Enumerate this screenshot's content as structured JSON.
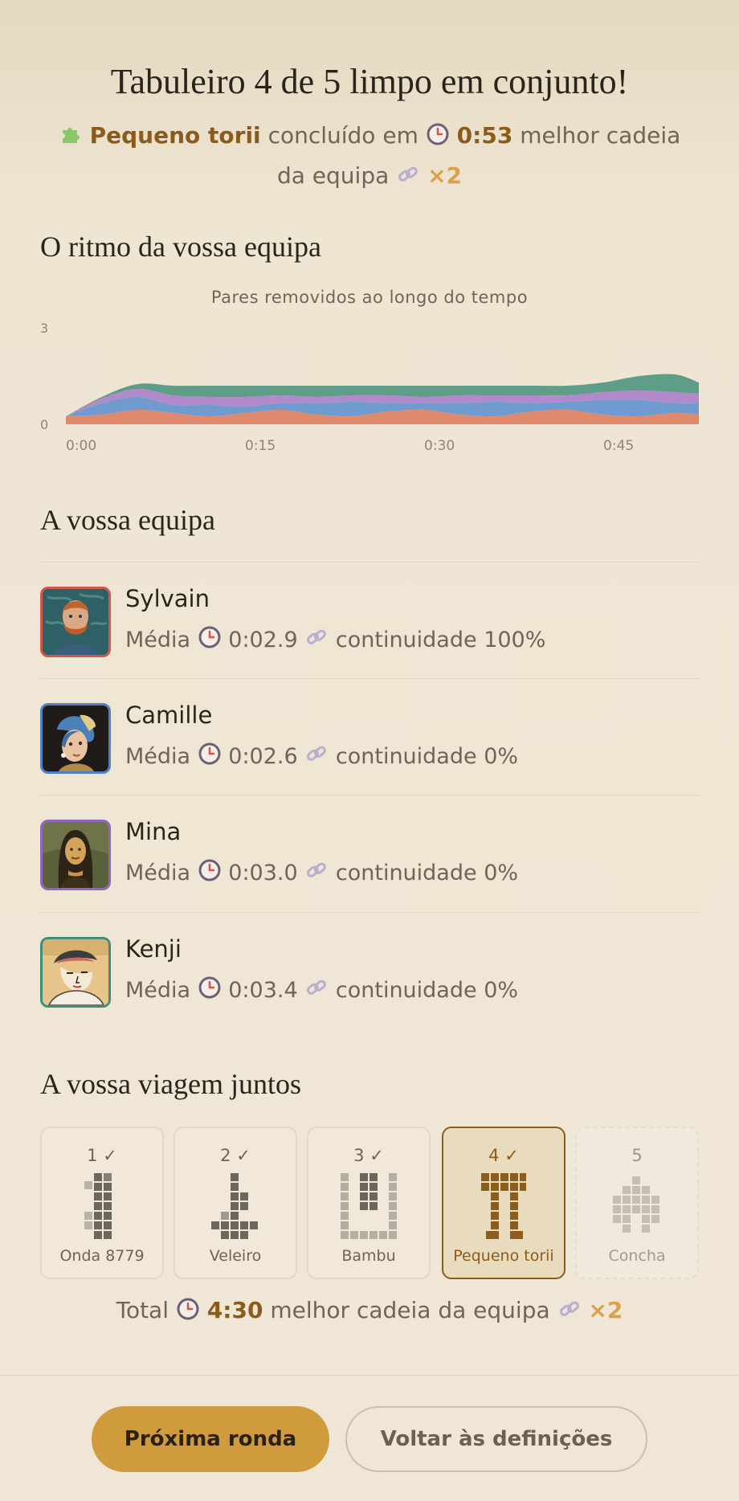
{
  "header": {
    "title": "Tabuleiro 4 de 5 limpo em conjunto!",
    "puzzle_name": "Pequeno torii",
    "completed_in": "concluído em",
    "time": "0:53",
    "best_chain_label": "melhor cadeia da equipa",
    "best_chain": "×2"
  },
  "rhythm": {
    "heading": "O ritmo da vossa equipa",
    "chart_title": "Pares removidos ao longo do tempo"
  },
  "chart_data": {
    "type": "area",
    "stacked": true,
    "title": "Pares removidos ao longo do tempo",
    "x_ticks": [
      "0:00",
      "0:15",
      "0:30",
      "0:45"
    ],
    "y_ticks": [
      "0",
      "3"
    ],
    "ylim": [
      0,
      3
    ],
    "x": [
      0,
      3,
      6,
      9,
      12,
      15,
      18,
      21,
      24,
      27,
      30,
      33,
      36,
      39,
      42,
      45,
      48,
      51,
      53
    ],
    "series": [
      {
        "color": "#e08a6d",
        "values": [
          0.25,
          0.3,
          0.45,
          0.35,
          0.25,
          0.35,
          0.45,
          0.3,
          0.25,
          0.4,
          0.45,
          0.3,
          0.25,
          0.4,
          0.45,
          0.3,
          0.25,
          0.35,
          0.3
        ]
      },
      {
        "color": "#6f9bd0",
        "values": [
          0,
          0.35,
          0.4,
          0.25,
          0.35,
          0.2,
          0.2,
          0.35,
          0.45,
          0.25,
          0.2,
          0.35,
          0.45,
          0.25,
          0.25,
          0.45,
          0.5,
          0.3,
          0.35
        ]
      },
      {
        "color": "#b08acb",
        "values": [
          0,
          0.15,
          0.25,
          0.3,
          0.25,
          0.3,
          0.25,
          0.2,
          0.2,
          0.25,
          0.2,
          0.25,
          0.2,
          0.25,
          0.2,
          0.25,
          0.3,
          0.35,
          0.3
        ]
      },
      {
        "color": "#5e9e88",
        "values": [
          0,
          0.05,
          0.15,
          0.3,
          0.35,
          0.35,
          0.3,
          0.35,
          0.3,
          0.3,
          0.35,
          0.3,
          0.3,
          0.3,
          0.3,
          0.3,
          0.45,
          0.55,
          0.35
        ]
      }
    ]
  },
  "team": {
    "heading": "A vossa equipa",
    "avg_label": "Média",
    "continuity_label": "continuidade",
    "players": [
      {
        "name": "Sylvain",
        "avg": "0:02.9",
        "continuity": "100%",
        "color": "#d0584a"
      },
      {
        "name": "Camille",
        "avg": "0:02.6",
        "continuity": "0%",
        "color": "#4f7fc4"
      },
      {
        "name": "Mina",
        "avg": "0:03.0",
        "continuity": "0%",
        "color": "#9166c0"
      },
      {
        "name": "Kenji",
        "avg": "0:03.4",
        "continuity": "0%",
        "color": "#3d8f78"
      }
    ]
  },
  "journey": {
    "heading": "A vossa viagem juntos",
    "boards": [
      {
        "num": "1 ✓",
        "name": "Onda 8779",
        "state": "done"
      },
      {
        "num": "2 ✓",
        "name": "Veleiro",
        "state": "done"
      },
      {
        "num": "3 ✓",
        "name": "Bambu",
        "state": "done"
      },
      {
        "num": "4 ✓",
        "name": "Pequeno torii",
        "state": "current"
      },
      {
        "num": "5",
        "name": "Concha",
        "state": "locked"
      }
    ],
    "total_label": "Total",
    "total_time": "4:30",
    "best_chain_label": "melhor cadeia da equipa",
    "best_chain": "×2"
  },
  "actions": {
    "next_round": "Próxima ronda",
    "back_to_settings": "Voltar às definições"
  }
}
